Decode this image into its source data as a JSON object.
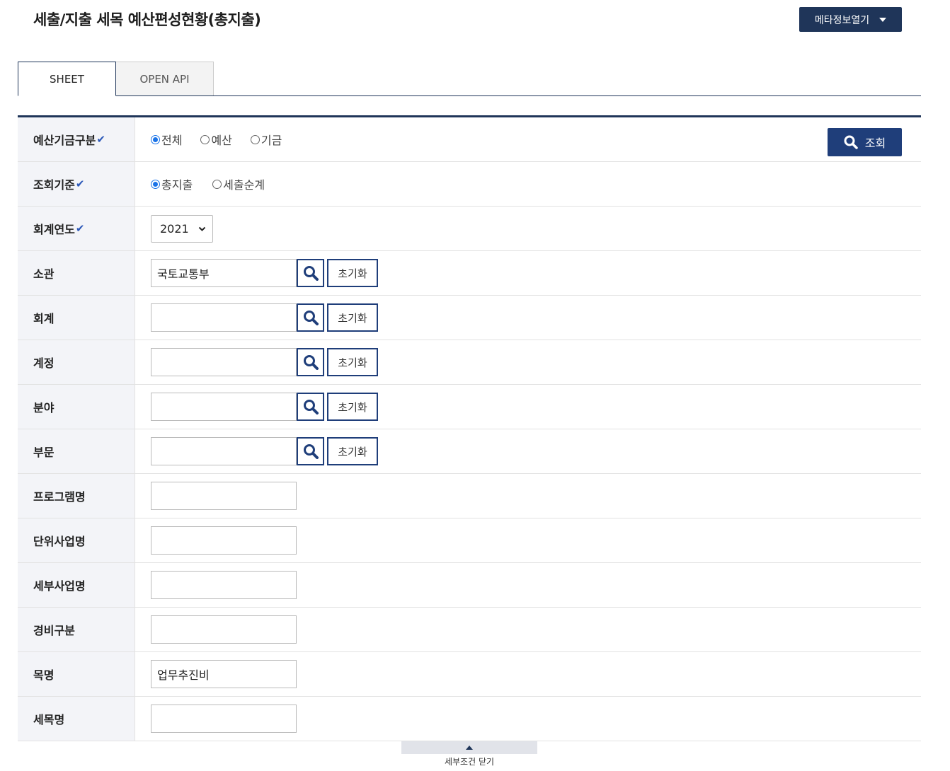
{
  "header": {
    "title": "세출/지출 세목 예산편성현황(총지출)",
    "meta_button_label": "메타정보열기"
  },
  "tabs": [
    {
      "label": "SHEET",
      "active": true
    },
    {
      "label": "OPEN API",
      "active": false
    }
  ],
  "form": {
    "budget_fund": {
      "label": "예산기금구분",
      "options": [
        "전체",
        "예산",
        "기금"
      ],
      "selected": "전체"
    },
    "basis": {
      "label": "조회기준",
      "options": [
        "총지출",
        "세출순계"
      ],
      "selected": "총지출"
    },
    "fiscal_year": {
      "label": "회계연도",
      "value": "2021"
    },
    "search_button_label": "조회",
    "reset_label": "초기화",
    "lookup_fields": [
      {
        "label": "소관",
        "value": "국토교통부"
      },
      {
        "label": "회계",
        "value": ""
      },
      {
        "label": "계정",
        "value": ""
      },
      {
        "label": "분야",
        "value": ""
      },
      {
        "label": "부문",
        "value": ""
      }
    ],
    "text_fields": [
      {
        "label": "프로그램명",
        "value": ""
      },
      {
        "label": "단위사업명",
        "value": ""
      },
      {
        "label": "세부사업명",
        "value": ""
      },
      {
        "label": "경비구분",
        "value": ""
      },
      {
        "label": "목명",
        "value": "업무추진비"
      },
      {
        "label": "세목명",
        "value": ""
      }
    ],
    "required_mark": "✔"
  },
  "footer": {
    "toggle_label": "세부조건 닫기"
  },
  "colors": {
    "navy": "#1f3559",
    "button_blue": "#1f3e7a",
    "label_bg": "#f3f4f8",
    "check_blue": "#2a57b8"
  }
}
